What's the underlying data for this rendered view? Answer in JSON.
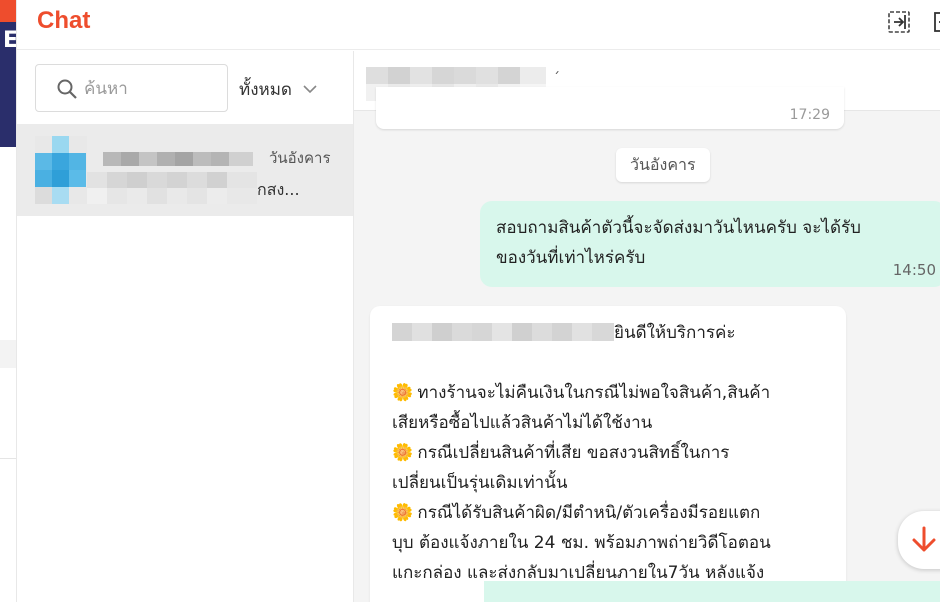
{
  "app": {
    "title": "Chat"
  },
  "header": {
    "exit_icon": "exit-icon",
    "minimize_icon": "minimize-icon"
  },
  "sidebar": {
    "search_placeholder": "ค้นหา",
    "filter_label": "ทั้งหมด",
    "conversation": {
      "date": "วันอังคาร",
      "preview": "กสง..."
    }
  },
  "pane": {
    "header_tail": "́",
    "old_time": "17:29",
    "day_divider": "วันอังคาร",
    "outgoing": {
      "line1": "สอบถามสินค้าตัวนี้จะจัดส่งมาวันไหนครับ จะได้รับ",
      "line2": "ของวันที่เท่าไหร่ครับ",
      "time": "14:50"
    },
    "incoming": {
      "greeting": "ยินดีให้บริการค่ะ",
      "line1": " ทางร้านจะไม่คืนเงินในกรณีไม่พอใจสินค้า,สินค้า",
      "line2": "เสียหรือซื้อไปแล้วสินค้าไม่ได้ใช้งาน",
      "line3": " กรณีเปลี่ยนสินค้าที่เสีย ขอสงวนสิทธิ์ในการ",
      "line4": "เปลี่ยนเป็นรุ่นเดิมเท่านั้น",
      "line5": " กรณีได้รับสินค้าผิด/มีตำหนิ/ตัวเครื่องมีรอยแตก",
      "line6": "บุบ ต้องแจ้งภายใน 24 ชม. พร้อมภาพถ่ายวิดีโอตอน",
      "line7": "แกะกล่อง และส่งกลับมาเปลี่ยนภายใน7วัน หลังแจ้ง",
      "flower_glyph": "🌼"
    }
  },
  "colors": {
    "brand": "#ee4d2d",
    "outgoing_bubble": "#d8f7ec",
    "selected_row": "#ebebeb"
  }
}
